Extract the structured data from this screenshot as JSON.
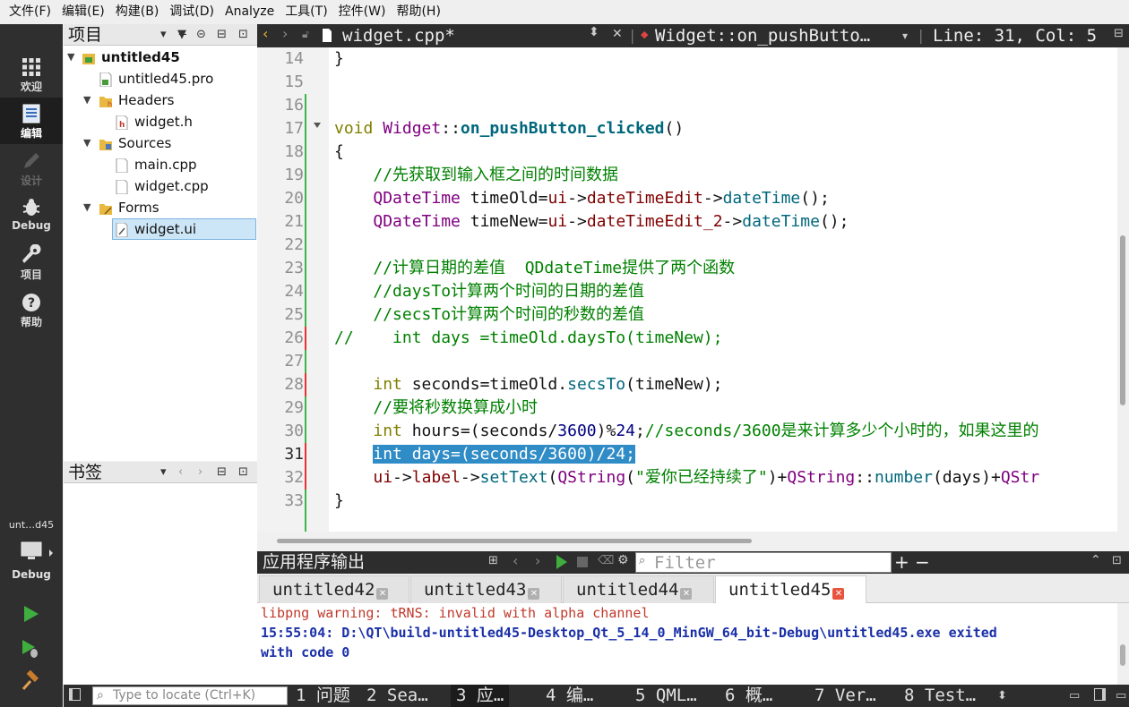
{
  "menubar": [
    "文件(F)",
    "编辑(E)",
    "构建(B)",
    "调试(D)",
    "Analyze",
    "工具(T)",
    "控件(W)",
    "帮助(H)"
  ],
  "modes": [
    {
      "label": "欢迎",
      "icon": "grid-icon",
      "state": "normal"
    },
    {
      "label": "编辑",
      "icon": "document-edit-icon",
      "state": "active"
    },
    {
      "label": "设计",
      "icon": "pencil-icon",
      "state": "disabled"
    },
    {
      "label": "Debug",
      "icon": "bug-icon",
      "state": "normal"
    },
    {
      "label": "项目",
      "icon": "wrench-icon",
      "state": "normal"
    },
    {
      "label": "帮助",
      "icon": "question-icon",
      "state": "normal"
    }
  ],
  "kit": {
    "name": "unt…d45",
    "config": "Debug"
  },
  "project_pane": {
    "title": "项目",
    "tree": [
      {
        "label": "untitled45",
        "level": 0,
        "expanded": true,
        "bold": true,
        "icon": "project-icon"
      },
      {
        "label": "untitled45.pro",
        "level": 1,
        "icon": "pro-file-icon"
      },
      {
        "label": "Headers",
        "level": 1,
        "expanded": true,
        "icon": "folder-h-icon"
      },
      {
        "label": "widget.h",
        "level": 2,
        "icon": "header-file-icon"
      },
      {
        "label": "Sources",
        "level": 1,
        "expanded": true,
        "icon": "folder-cpp-icon"
      },
      {
        "label": "main.cpp",
        "level": 2,
        "icon": "cpp-file-icon"
      },
      {
        "label": "widget.cpp",
        "level": 2,
        "icon": "cpp-file-icon"
      },
      {
        "label": "Forms",
        "level": 1,
        "expanded": true,
        "icon": "folder-ui-icon"
      },
      {
        "label": "widget.ui",
        "level": 2,
        "icon": "ui-file-icon",
        "selected": true
      }
    ]
  },
  "bookmark_pane": {
    "title": "书签"
  },
  "editor": {
    "file_tab": "widget.cpp*",
    "symbol": "Widget::on_pushButto…",
    "position": "Line: 31, Col: 5",
    "current_line": 31,
    "lines": [
      {
        "n": "14",
        "html": "}"
      },
      {
        "n": "15",
        "html": ""
      },
      {
        "n": "16",
        "html": ""
      },
      {
        "n": "17",
        "html": "<span class='kw'>void</span> <span class='ty'>Widget</span>::<span class='fn'>on_pushButton_clicked</span>()",
        "fold": true
      },
      {
        "n": "18",
        "html": "{"
      },
      {
        "n": "19",
        "html": "    <span class='cm'>//先获取到输入框之间的时间数据</span>"
      },
      {
        "n": "20",
        "html": "    <span class='ty'>QDateTime</span> timeOld=<span class='mem'>ui</span>-><span class='mem'>dateTimeEdit</span>-><span class='call'>dateTime</span>();"
      },
      {
        "n": "21",
        "html": "    <span class='ty'>QDateTime</span> timeNew=<span class='mem'>ui</span>-><span class='mem'>dateTimeEdit_2</span>-><span class='call'>dateTime</span>();"
      },
      {
        "n": "22",
        "html": ""
      },
      {
        "n": "23",
        "html": "    <span class='cm'>//计算日期的差值  QDdateTime提供了两个函数</span>"
      },
      {
        "n": "24",
        "html": "    <span class='cm'>//daysTo计算两个时间的日期的差值</span>"
      },
      {
        "n": "25",
        "html": "    <span class='cm'>//secsTo计算两个时间的秒数的差值</span>"
      },
      {
        "n": "26",
        "html": "<span class='cm'>//    int days =timeOld.daysTo(timeNew);</span>"
      },
      {
        "n": "27",
        "html": ""
      },
      {
        "n": "28",
        "html": "    <span class='kw'>int</span> seconds=timeOld.<span class='call'>secsTo</span>(timeNew);"
      },
      {
        "n": "29",
        "html": "    <span class='cm'>//要将秒数换算成小时</span>"
      },
      {
        "n": "30",
        "html": "    <span class='kw'>int</span> hours=(seconds/<span class='num'>3600</span>)%<span class='num'>24</span>;<span class='cm'>//seconds/3600是来计算多少个小时的，如果这里的</span>"
      },
      {
        "n": "31",
        "html": "    <span class='sel'>int days=(seconds/3600)/24;</span>"
      },
      {
        "n": "32",
        "html": "    <span class='mem'>ui</span>-><span class='mem'>label</span>-><span class='call'>setText</span>(<span class='ty'>QString</span>(<span class='str'>\"爱你已经持续了\"</span>)+<span class='ty'>QString</span>::<span class='call'>number</span>(days)+<span class='ty'>QStr</span>"
      },
      {
        "n": "33",
        "html": "}"
      }
    ]
  },
  "output": {
    "title": "应用程序输出",
    "filter_placeholder": "Filter",
    "tabs": [
      {
        "label": "untitled42",
        "active": false
      },
      {
        "label": "untitled43",
        "active": false
      },
      {
        "label": "untitled44",
        "active": false
      },
      {
        "label": "untitled45",
        "active": true
      }
    ],
    "lines": [
      {
        "text": "libpng warning: tRNS: invalid with alpha channel",
        "color": "#c0392b",
        "bold": false
      },
      {
        "text": "15:55:04: D:\\QT\\build-untitled45-Desktop_Qt_5_14_0_MinGW_64_bit-Debug\\untitled45.exe exited",
        "color": "#1a2fa8",
        "bold": true
      },
      {
        "text": "with code 0",
        "color": "#1a2fa8",
        "bold": true
      }
    ]
  },
  "statusbar": {
    "locator_placeholder": "Type to locate (Ctrl+K)",
    "items": [
      {
        "label": "1 问题",
        "active": false
      },
      {
        "label": "2 Sea…",
        "active": false
      },
      {
        "label": "3 应…",
        "active": true
      },
      {
        "label": "4 编…",
        "active": false
      },
      {
        "label": "5 QML…",
        "active": false
      },
      {
        "label": "6 概…",
        "active": false
      },
      {
        "label": "7 Ver…",
        "active": false
      },
      {
        "label": "8 Test…",
        "active": false
      }
    ]
  },
  "colors": {
    "selection": "#308cc6",
    "comment": "#008000",
    "type": "#800080",
    "keyword": "#808000",
    "dark_panel": "#2d2d2d"
  }
}
